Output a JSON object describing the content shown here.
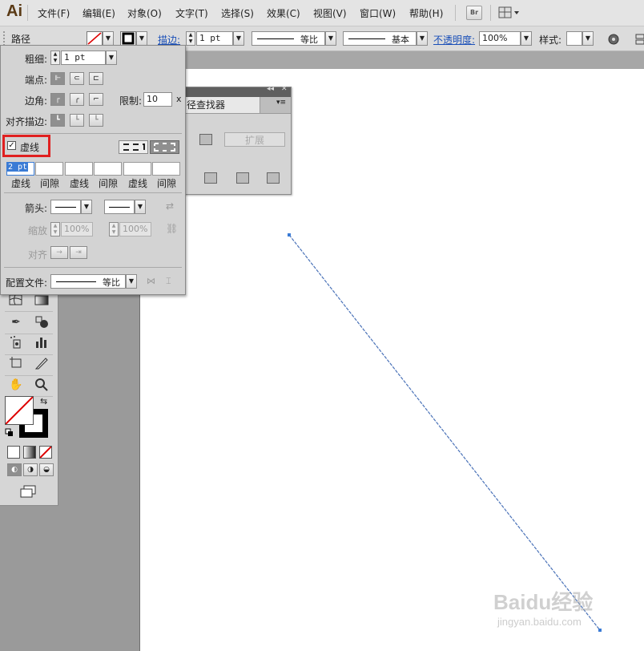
{
  "app": {
    "logo": "Ai"
  },
  "menu": {
    "items": [
      "文件(F)",
      "编辑(E)",
      "对象(O)",
      "文字(T)",
      "选择(S)",
      "效果(C)",
      "视图(V)",
      "窗口(W)",
      "帮助(H)"
    ],
    "bridge_label": "Br"
  },
  "control_bar": {
    "selection_label": "路径",
    "stroke_label": "描边:",
    "stroke_weight": "1 pt",
    "profile_label": "等比",
    "brush_label": "基本",
    "opacity_label": "不透明度:",
    "opacity_value": "100%",
    "style_label": "样式:"
  },
  "stroke_panel": {
    "weight_label": "粗细:",
    "weight_value": "1 pt",
    "cap_label": "端点:",
    "corner_label": "边角:",
    "limit_label": "限制:",
    "limit_value": "10",
    "limit_unit": "x",
    "align_label": "对齐描边:",
    "dashed_label": "虚线",
    "dashed_checked": true,
    "dash_fields": [
      {
        "value": "2 pt",
        "label": "虚线"
      },
      {
        "value": "",
        "label": "间隙"
      },
      {
        "value": "",
        "label": "虚线"
      },
      {
        "value": "",
        "label": "间隙"
      },
      {
        "value": "",
        "label": "虚线"
      },
      {
        "value": "",
        "label": "间隙"
      }
    ],
    "arrow_label": "箭头:",
    "scale_label": "缩放",
    "scale_start": "100%",
    "scale_end": "100%",
    "align_arrow_label": "对齐",
    "profile_label": "配置文件:",
    "profile_value": "等比"
  },
  "pathfinder_panel": {
    "title": "径查找器",
    "expand_label": "扩展"
  },
  "watermark": {
    "line1": "Baidu经验",
    "line2": "jingyan.baidu.com"
  },
  "colors": {
    "highlight": "#e02020",
    "path_stroke": "#4a72b8",
    "selection": "#3a7bd5"
  }
}
